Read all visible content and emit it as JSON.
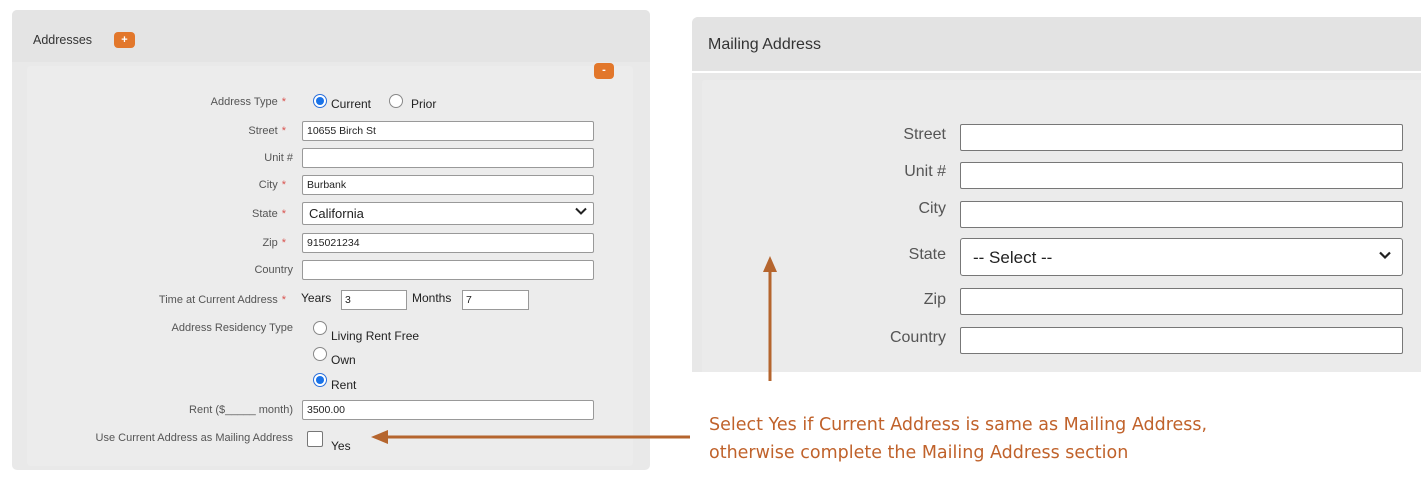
{
  "addresses": {
    "title": "Addresses",
    "add_label": "+",
    "remove_label": "-",
    "address_type": {
      "label": "Address Type",
      "options": [
        "Current",
        "Prior"
      ],
      "selected": "Current"
    },
    "street": {
      "label": "Street",
      "value": "10655 Birch St"
    },
    "unit": {
      "label": "Unit #",
      "value": ""
    },
    "city": {
      "label": "City",
      "value": "Burbank"
    },
    "state": {
      "label": "State",
      "value": "California"
    },
    "zip": {
      "label": "Zip",
      "value": "915021234"
    },
    "country": {
      "label": "Country",
      "value": ""
    },
    "time_at_address": {
      "label": "Time at Current Address",
      "years_label": "Years",
      "years_value": "3",
      "months_label": "Months",
      "months_value": "7"
    },
    "residency": {
      "label": "Address Residency Type",
      "options": [
        "Living Rent Free",
        "Own",
        "Rent"
      ],
      "selected": "Rent"
    },
    "rent": {
      "label": "Rent ($_____ month)",
      "value": "3500.00"
    },
    "use_current": {
      "label": "Use Current Address as Mailing Address",
      "option": "Yes",
      "checked": false
    },
    "required_mark": "*"
  },
  "mailing": {
    "title": "Mailing Address",
    "street_label": "Street",
    "unit_label": "Unit #",
    "city_label": "City",
    "state_label": "State",
    "state_value": "-- Select --",
    "zip_label": "Zip",
    "country_label": "Country"
  },
  "annotation": {
    "line1": "Select Yes if Current Address is same as Mailing Address,",
    "line2": "otherwise complete the Mailing Address section",
    "color": "#c0622b"
  },
  "icons": {
    "dropdown": "chevron-down-icon"
  }
}
